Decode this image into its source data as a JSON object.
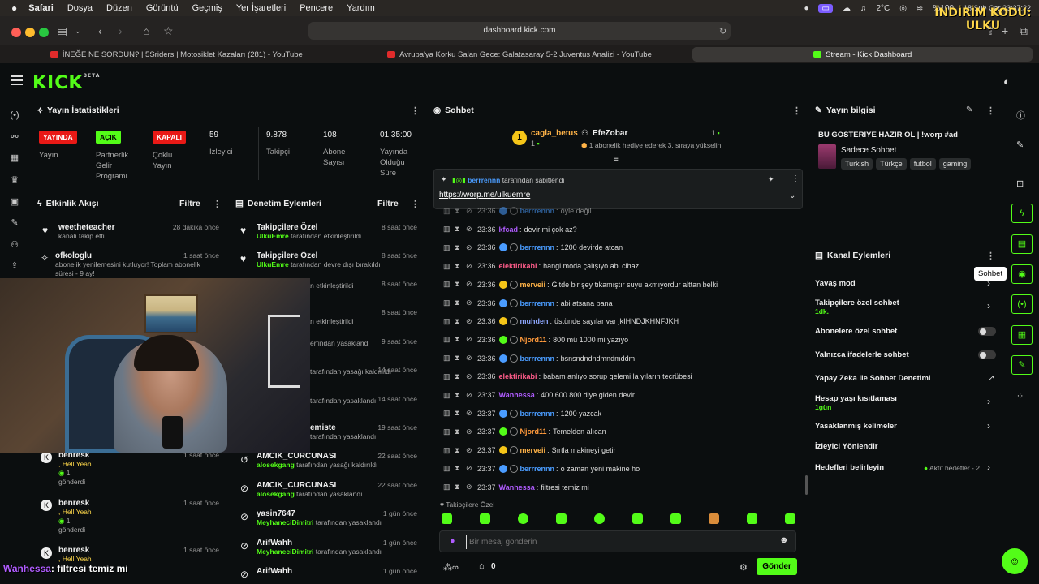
{
  "menubar": {
    "app": "Safari",
    "items": [
      "Dosya",
      "Düzen",
      "Görüntü",
      "Geçmiş",
      "Yer İşaretleri",
      "Pencere",
      "Yardım"
    ],
    "weather": "2°C",
    "battery": "%100",
    "clock": "18 Şub Çar 23:37:32",
    "overlay_line1": "İNDİRİM KODU:",
    "overlay_line2": "ULKU"
  },
  "browser": {
    "url": "dashboard.kick.com",
    "tabs": [
      "İNEĞE NE SORDUN? | 5Sriders | Motosiklet Kazaları (281) - YouTube",
      "Avrupa'ya Korku Salan Gece: Galatasaray 5-2 Juventus Analizi - YouTube",
      "Stream - Kick Dashboard"
    ]
  },
  "kick": {
    "logo": "KICK",
    "beta": "BETA"
  },
  "stats": {
    "title": "Yayın İstatistikleri",
    "items": [
      {
        "badge": "YAYINDA",
        "label": "Yayın"
      },
      {
        "badge": "AÇIK",
        "label": "Partnerlik Gelir Programı"
      },
      {
        "badge": "KAPALI",
        "label": "Çoklu Yayın"
      },
      {
        "value": "59",
        "label": "İzleyici"
      },
      {
        "value": "9.878",
        "label": "Takipçi"
      },
      {
        "value": "108",
        "label": "Abone Sayısı"
      },
      {
        "value": "01:35:00",
        "label": "Yayında Olduğu Süre"
      }
    ]
  },
  "activity": {
    "title": "Etkinlik Akışı",
    "filter": "Filtre",
    "items": [
      {
        "name": "weetheteacher",
        "sub": "kanalı takip etti",
        "ago": "28 dakika önce"
      },
      {
        "name": "ofkologlu",
        "sub": "abonelik yenilemesini kutluyor! Toplam abonelik süresi - 9 ay!",
        "ago": "1 saat önce"
      },
      {
        "name": "benresk",
        "sub": ", Hell Yeah",
        "sub2": "1",
        "sub3": "gönderdi",
        "ago": "1 saat önce"
      },
      {
        "name": "benresk",
        "sub": ", Hell Yeah",
        "sub2": "1",
        "sub3": "gönderdi",
        "ago": "1 saat önce"
      },
      {
        "name": "benresk",
        "sub": ", Hell Yeah",
        "sub2": "1",
        "sub3": "gönderdi",
        "ago": "1 saat önce"
      }
    ]
  },
  "moderation": {
    "title": "Denetim Eylemleri",
    "filter": "Filtre",
    "items": [
      {
        "name": "Takipçilere Özel",
        "actor": "UlkuEmre",
        "action": "tarafından etkinleştirildi",
        "ago": "8 saat önce"
      },
      {
        "name": "Takipçilere Özel",
        "actor": "UlkuEmre",
        "action": "tarafından devre dışı bırakıldı",
        "ago": "8 saat önce"
      },
      {
        "name": "",
        "actor": "",
        "action": "ndan etkinleştirildi",
        "ago": "8 saat önce"
      },
      {
        "name": "el",
        "actor": "",
        "action": "ndan etkinleştirildi",
        "ago": "8 saat önce"
      },
      {
        "name": "",
        "actor": "",
        "action": "erfindan yasaklandı",
        "ago": "9 saat önce"
      },
      {
        "name": "",
        "actor": "",
        "action": "tarafından yasağı kaldırıldı",
        "ago": "14 saat önce"
      },
      {
        "name": "",
        "actor": "",
        "action": "tarafından yasaklandı",
        "ago": "14 saat önce"
      },
      {
        "name": "emiste",
        "actor": "",
        "action": "tarafından yasaklandı",
        "ago": "19 saat önce"
      },
      {
        "name": "AMCIK_CURCUNASI",
        "actor": "alosekgang",
        "action": "tarafından yasağı kaldırıldı",
        "ago": "22 saat önce"
      },
      {
        "name": "AMCIK_CURCUNASI",
        "actor": "alosekgang",
        "action": "tarafından yasaklandı",
        "ago": "22 saat önce"
      },
      {
        "name": "yasin7647",
        "actor": "MeyhaneciDimitri",
        "action": "tarafından yasaklandı",
        "ago": "1 gün önce"
      },
      {
        "name": "ArifWahh",
        "actor": "MeyhaneciDimitri",
        "action": "tarafından yasaklandı",
        "ago": "1 gün önce"
      },
      {
        "name": "ArifWahh",
        "actor": "",
        "action": "",
        "ago": "1 gün önce"
      }
    ]
  },
  "chat": {
    "title": "Sohbet",
    "top_user": "cagla_betus",
    "top_user_count": "1",
    "gifter": "EfeZobar",
    "gifter_count": "1",
    "gift_text": "1 abonelik hediye ederek 3. sıraya yükselin",
    "pinned_by": "berrrennn",
    "pinned_label": "tarafından sabitlendi",
    "pinned_link": "https://worp.me/ulkuemre",
    "followers_only": "Takipçilere Özel",
    "placeholder": "Bir mesaj gönderin",
    "send": "Gönder",
    "kicks": "0",
    "messages": [
      {
        "t": "23:36",
        "u": "berrrennn",
        "m": "öyle değil",
        "c": "#4a9cff"
      },
      {
        "t": "23:36",
        "u": "kfcad",
        "m": "devir mi çok az?",
        "c": "#b05cff"
      },
      {
        "t": "23:36",
        "u": "berrrennn",
        "m": "1200 devirde atcan",
        "c": "#4a9cff"
      },
      {
        "t": "23:36",
        "u": "elektirikabi",
        "m": "hangi moda çalışıyo abi cihaz",
        "c": "#ff5c8a"
      },
      {
        "t": "23:36",
        "u": "merveii",
        "m": "Gitde bir şey tıkamıştır suyu akmıyordur alttan belki",
        "c": "#ffb347"
      },
      {
        "t": "23:36",
        "u": "berrrennn",
        "m": "abi atsana bana",
        "c": "#4a9cff"
      },
      {
        "t": "23:36",
        "u": "muhden",
        "m": "üstünde sayılar var jkIHNDJKHNFJKH",
        "c": "#8fa8ff"
      },
      {
        "t": "23:36",
        "u": "Njord11",
        "m": "800 mü 1000 mi yazıyo",
        "c": "#ff9a3c"
      },
      {
        "t": "23:36",
        "u": "berrrennn",
        "m": "bsnsndndndmndmddm",
        "c": "#4a9cff"
      },
      {
        "t": "23:36",
        "u": "elektirikabi",
        "m": "babam anlıyo sorup gelemi la yıların tecrübesi",
        "c": "#ff5c8a"
      },
      {
        "t": "23:37",
        "u": "Wanhessa",
        "m": "400 600 800 diye giden devir",
        "c": "#b05cff"
      },
      {
        "t": "23:37",
        "u": "berrrennn",
        "m": "1200 yazcak",
        "c": "#4a9cff"
      },
      {
        "t": "23:37",
        "u": "Njord11",
        "m": "Temelden alıcan",
        "c": "#ff9a3c"
      },
      {
        "t": "23:37",
        "u": "merveii",
        "m": "Sırtla makineyi getir",
        "c": "#ffb347"
      },
      {
        "t": "23:37",
        "u": "berrrennn",
        "m": "o zaman yeni makine ho",
        "c": "#4a9cff"
      },
      {
        "t": "23:37",
        "u": "Wanhessa",
        "m": "filtresi temiz mi",
        "c": "#b05cff"
      }
    ]
  },
  "stream_info": {
    "title": "Yayın bilgisi",
    "stream_title": "BU GÖSTERİYE HAZIR OL | !worp #ad",
    "mode": "Sadece Sohbet",
    "tags": [
      "Turkish",
      "Türkçe",
      "futbol",
      "gaming"
    ]
  },
  "channel_actions": {
    "title": "Kanal Eylemleri",
    "items": [
      {
        "label": "Yavaş mod",
        "sub": ""
      },
      {
        "label": "Takipçilere özel sohbet",
        "sub": "1dk."
      },
      {
        "label": "Abonelere özel sohbet",
        "sub": ""
      },
      {
        "label": "Yalnızca ifadelerle sohbet",
        "sub": ""
      },
      {
        "label": "Yapay Zeka ile Sohbet Denetimi",
        "sub": ""
      },
      {
        "label": "Hesap yaşı kısıtlaması",
        "sub": "1gün"
      },
      {
        "label": "Yasaklanmış kelimeler",
        "sub": ""
      },
      {
        "label": "İzleyici Yönlendir",
        "sub": ""
      },
      {
        "label": "Hedefleri belirleyin",
        "sub": ""
      }
    ],
    "active_goals": "Aktif hedefler - 2"
  },
  "tooltip": "Sohbet",
  "overlay_chat": {
    "user": "Wanhessa",
    "message": ": filtresi temiz mi"
  }
}
